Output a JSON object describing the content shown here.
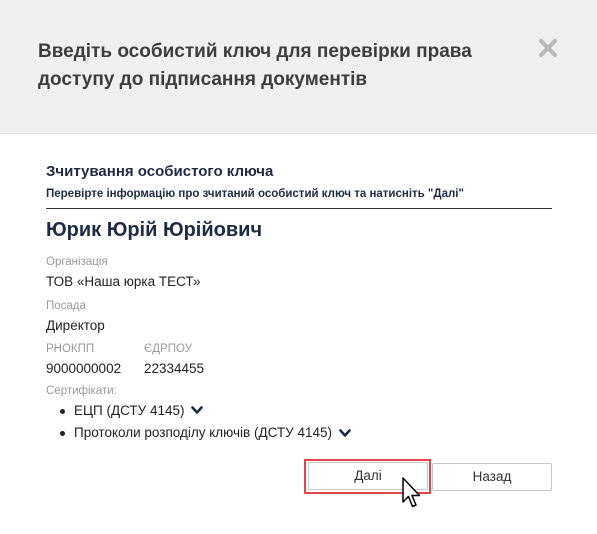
{
  "header": {
    "title": "Введіть особистий ключ для перевірки права доступу до підписання документів",
    "close_icon": "close-icon"
  },
  "section": {
    "title": "Зчитування особистого ключа",
    "subtitle": "Перевірте інформацію про зчитаний особистий ключ та натисніть \"Далі\""
  },
  "person": {
    "name": "Юрик Юрій Юрійович"
  },
  "fields": {
    "organization": {
      "label": "Організація",
      "value": "ТОВ «Наша юрка ТЕСТ»"
    },
    "position": {
      "label": "Посада",
      "value": "Директор"
    },
    "rnokpp": {
      "label": "РНОКПП",
      "value": "9000000002"
    },
    "edrpou": {
      "label": "ЄДРПОУ",
      "value": "22334455"
    },
    "certificates": {
      "label": "Сертифікати:",
      "items": [
        {
          "label": "ЕЦП (ДСТУ 4145)",
          "icon": "chevron-down-icon"
        },
        {
          "label": "Протоколи розподілу ключів (ДСТУ 4145)",
          "icon": "chevron-down-icon"
        }
      ]
    }
  },
  "buttons": {
    "next_label": "Далі",
    "back_label": "Назад"
  },
  "colors": {
    "header_bg": "#f0f0f0",
    "title_text": "#3d3d3d",
    "heading_text": "#1f2a44",
    "label_text": "#9a9a9a",
    "focus_outline": "#e2454a"
  }
}
